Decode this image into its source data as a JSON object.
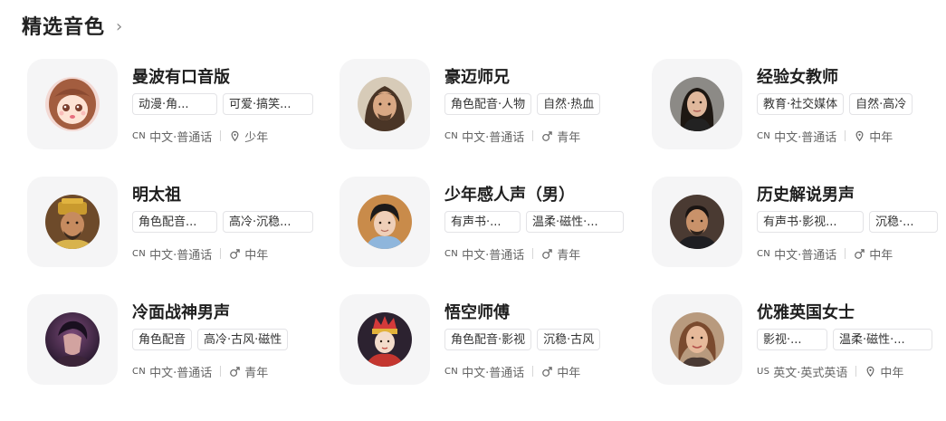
{
  "section": {
    "title": "精选音色",
    "chevron": "›"
  },
  "voices": [
    {
      "name": "曼波有口音版",
      "tags": [
        "动漫·角...",
        "可爱·搞笑..."
      ],
      "lang_code": "CN",
      "lang": "中文·普通话",
      "age_icon": "location-pin-icon",
      "age": "少年",
      "avatar": "anime-girl-avatar"
    },
    {
      "name": "豪迈师兄",
      "tags": [
        "角色配音·人物",
        "自然·热血"
      ],
      "lang_code": "CN",
      "lang": "中文·普通话",
      "age_icon": "male-icon",
      "age": "青年",
      "avatar": "long-hair-man-avatar"
    },
    {
      "name": "经验女教师",
      "tags": [
        "教育·社交媒体",
        "自然·高冷"
      ],
      "lang_code": "CN",
      "lang": "中文·普通话",
      "age_icon": "location-pin-icon",
      "age": "中年",
      "avatar": "woman-teacher-avatar"
    },
    {
      "name": "明太祖",
      "tags": [
        "角色配音...",
        "高冷·沉稳..."
      ],
      "lang_code": "CN",
      "lang": "中文·普通话",
      "age_icon": "male-icon",
      "age": "中年",
      "avatar": "emperor-avatar"
    },
    {
      "name": "少年感人声（男）",
      "tags": [
        "有声书·...",
        "温柔·磁性·..."
      ],
      "lang_code": "CN",
      "lang": "中文·普通话",
      "age_icon": "male-icon",
      "age": "青年",
      "avatar": "young-man-avatar"
    },
    {
      "name": "历史解说男声",
      "tags": [
        "有声书·影视...",
        "沉稳·..."
      ],
      "lang_code": "CN",
      "lang": "中文·普通话",
      "age_icon": "male-icon",
      "age": "中年",
      "avatar": "narrator-man-avatar"
    },
    {
      "name": "冷面战神男声",
      "tags": [
        "角色配音",
        "高冷·古风·磁性"
      ],
      "lang_code": "CN",
      "lang": "中文·普通话",
      "age_icon": "male-icon",
      "age": "青年",
      "avatar": "warrior-avatar"
    },
    {
      "name": "悟空师傅",
      "tags": [
        "角色配音·影视",
        "沉稳·古风"
      ],
      "lang_code": "CN",
      "lang": "中文·普通话",
      "age_icon": "male-icon",
      "age": "中年",
      "avatar": "monk-avatar"
    },
    {
      "name": "优雅英国女士",
      "tags": [
        "影视·...",
        "温柔·磁性·..."
      ],
      "lang_code": "US",
      "lang": "英文·英式英语",
      "age_icon": "location-pin-icon",
      "age": "中年",
      "avatar": "elegant-lady-avatar"
    }
  ]
}
